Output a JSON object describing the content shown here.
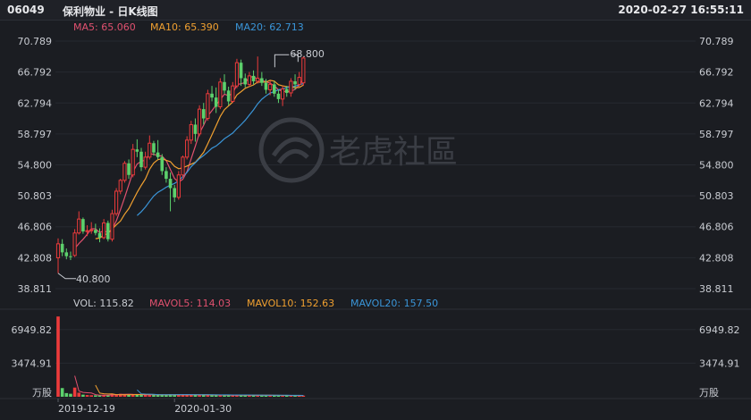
{
  "header": {
    "code": "06049",
    "name": "保利物业 - 日K线图",
    "datetime": "2020-02-27 16:55:11"
  },
  "ma_legend": [
    {
      "label": "MA5: 65.060",
      "color": "#e0516f"
    },
    {
      "label": "MA10: 65.390",
      "color": "#f0a030"
    },
    {
      "label": "MA20: 62.713",
      "color": "#3a95d8"
    }
  ],
  "vol_legend": [
    {
      "label": "VOL: 115.82",
      "color": "#c9ccd2"
    },
    {
      "label": "MAVOL5: 114.03",
      "color": "#e0516f"
    },
    {
      "label": "MAVOL10: 152.63",
      "color": "#f0a030"
    },
    {
      "label": "MAVOL20: 157.50",
      "color": "#3a95d8"
    }
  ],
  "watermark": "老虎社區",
  "colors": {
    "up": "#ec3b3b",
    "down": "#5cd16c"
  },
  "chart_data": [
    {
      "type": "candlestick",
      "title": "保利物业 - 日K线图",
      "price_ticks": [
        "70.789",
        "66.792",
        "62.794",
        "58.797",
        "54.800",
        "50.803",
        "46.806",
        "42.808",
        "38.811"
      ],
      "ylim": [
        38.811,
        70.789
      ],
      "annotations": [
        {
          "label": "68.800",
          "index": 59
        },
        {
          "label": "40.800",
          "index": 0
        }
      ],
      "x_tick_labels": [
        {
          "label": "2019-12-19",
          "index": 0
        },
        {
          "label": "2020-01-30",
          "index": 28
        }
      ],
      "candles": [
        {
          "o": 42.8,
          "h": 45.3,
          "l": 40.8,
          "c": 44.6
        },
        {
          "o": 44.6,
          "h": 45.2,
          "l": 43.0,
          "c": 43.5
        },
        {
          "o": 43.5,
          "h": 44.0,
          "l": 42.6,
          "c": 43.0
        },
        {
          "o": 43.0,
          "h": 43.6,
          "l": 42.5,
          "c": 42.9
        },
        {
          "o": 43.1,
          "h": 46.5,
          "l": 42.9,
          "c": 46.0
        },
        {
          "o": 46.0,
          "h": 48.8,
          "l": 45.8,
          "c": 47.8
        },
        {
          "o": 47.8,
          "h": 48.0,
          "l": 45.9,
          "c": 46.2
        },
        {
          "o": 46.2,
          "h": 47.0,
          "l": 45.6,
          "c": 46.3
        },
        {
          "o": 46.3,
          "h": 47.4,
          "l": 45.9,
          "c": 46.4
        },
        {
          "o": 46.4,
          "h": 47.2,
          "l": 45.7,
          "c": 46.0
        },
        {
          "o": 46.0,
          "h": 46.6,
          "l": 44.8,
          "c": 45.4
        },
        {
          "o": 45.4,
          "h": 47.8,
          "l": 45.2,
          "c": 47.3
        },
        {
          "o": 47.3,
          "h": 47.6,
          "l": 44.9,
          "c": 45.2
        },
        {
          "o": 45.2,
          "h": 49.0,
          "l": 44.9,
          "c": 48.5
        },
        {
          "o": 48.5,
          "h": 51.8,
          "l": 48.2,
          "c": 51.4
        },
        {
          "o": 51.4,
          "h": 53.0,
          "l": 51.0,
          "c": 52.8
        },
        {
          "o": 52.8,
          "h": 55.3,
          "l": 52.5,
          "c": 55.0
        },
        {
          "o": 55.0,
          "h": 55.5,
          "l": 53.0,
          "c": 53.5
        },
        {
          "o": 53.5,
          "h": 57.5,
          "l": 53.2,
          "c": 56.8
        },
        {
          "o": 56.8,
          "h": 58.1,
          "l": 55.8,
          "c": 56.5
        },
        {
          "o": 56.5,
          "h": 57.0,
          "l": 54.0,
          "c": 54.5
        },
        {
          "o": 54.5,
          "h": 56.5,
          "l": 54.2,
          "c": 55.8
        },
        {
          "o": 55.8,
          "h": 58.6,
          "l": 55.5,
          "c": 57.6
        },
        {
          "o": 57.6,
          "h": 57.9,
          "l": 56.0,
          "c": 56.4
        },
        {
          "o": 56.4,
          "h": 58.0,
          "l": 55.5,
          "c": 55.8
        },
        {
          "o": 55.8,
          "h": 56.2,
          "l": 53.5,
          "c": 54.0
        },
        {
          "o": 54.0,
          "h": 54.5,
          "l": 52.5,
          "c": 53.0
        },
        {
          "o": 53.0,
          "h": 53.8,
          "l": 48.8,
          "c": 51.8
        },
        {
          "o": 51.8,
          "h": 52.2,
          "l": 50.0,
          "c": 50.6
        },
        {
          "o": 50.6,
          "h": 54.0,
          "l": 50.3,
          "c": 53.5
        },
        {
          "o": 53.5,
          "h": 56.0,
          "l": 53.2,
          "c": 55.8
        },
        {
          "o": 55.8,
          "h": 58.5,
          "l": 55.5,
          "c": 58.0
        },
        {
          "o": 58.0,
          "h": 60.5,
          "l": 57.5,
          "c": 60.0
        },
        {
          "o": 60.0,
          "h": 60.8,
          "l": 57.8,
          "c": 58.8
        },
        {
          "o": 58.8,
          "h": 62.5,
          "l": 58.5,
          "c": 62.0
        },
        {
          "o": 62.0,
          "h": 62.8,
          "l": 60.0,
          "c": 60.8
        },
        {
          "o": 60.8,
          "h": 64.5,
          "l": 60.5,
          "c": 64.0
        },
        {
          "o": 64.0,
          "h": 65.0,
          "l": 63.0,
          "c": 63.5
        },
        {
          "o": 63.5,
          "h": 64.8,
          "l": 61.5,
          "c": 62.3
        },
        {
          "o": 62.3,
          "h": 66.0,
          "l": 62.0,
          "c": 65.5
        },
        {
          "o": 65.5,
          "h": 66.5,
          "l": 64.0,
          "c": 64.4
        },
        {
          "o": 64.4,
          "h": 64.9,
          "l": 62.5,
          "c": 63.0
        },
        {
          "o": 63.0,
          "h": 65.5,
          "l": 62.8,
          "c": 65.0
        },
        {
          "o": 65.0,
          "h": 68.5,
          "l": 64.7,
          "c": 68.0
        },
        {
          "o": 68.0,
          "h": 68.4,
          "l": 65.0,
          "c": 66.0
        },
        {
          "o": 66.0,
          "h": 66.6,
          "l": 64.8,
          "c": 65.2
        },
        {
          "o": 65.2,
          "h": 66.8,
          "l": 64.9,
          "c": 66.3
        },
        {
          "o": 66.3,
          "h": 67.0,
          "l": 65.2,
          "c": 65.6
        },
        {
          "o": 65.6,
          "h": 68.8,
          "l": 65.3,
          "c": 66.0
        },
        {
          "o": 66.0,
          "h": 66.8,
          "l": 65.0,
          "c": 65.4
        },
        {
          "o": 65.4,
          "h": 65.9,
          "l": 64.0,
          "c": 64.5
        },
        {
          "o": 64.5,
          "h": 65.7,
          "l": 63.8,
          "c": 65.2
        },
        {
          "o": 65.2,
          "h": 65.6,
          "l": 63.6,
          "c": 64.0
        },
        {
          "o": 64.0,
          "h": 64.5,
          "l": 62.8,
          "c": 63.3
        },
        {
          "o": 63.3,
          "h": 65.0,
          "l": 62.4,
          "c": 64.6
        },
        {
          "o": 64.6,
          "h": 65.0,
          "l": 63.6,
          "c": 64.1
        },
        {
          "o": 64.1,
          "h": 66.0,
          "l": 63.6,
          "c": 65.6
        },
        {
          "o": 65.6,
          "h": 66.5,
          "l": 64.5,
          "c": 65.2
        },
        {
          "o": 65.2,
          "h": 66.8,
          "l": 64.9,
          "c": 66.1
        },
        {
          "o": 65.4,
          "h": 68.8,
          "l": 65.0,
          "c": 68.6
        }
      ]
    },
    {
      "type": "bar",
      "title": "VOL",
      "y_ticks": [
        "6949.82",
        "3474.91"
      ],
      "unit_label": "万股",
      "ylim": [
        0,
        8500
      ],
      "values": [
        8300,
        900,
        380,
        310,
        950,
        420,
        220,
        180,
        160,
        150,
        130,
        210,
        170,
        330,
        260,
        300,
        250,
        200,
        230,
        220,
        190,
        210,
        230,
        200,
        180,
        190,
        170,
        260,
        210,
        230,
        190,
        200,
        210,
        190,
        200,
        170,
        180,
        160,
        170,
        180,
        150,
        160,
        170,
        190,
        160,
        150,
        140,
        150,
        160,
        140,
        130,
        150,
        140,
        130,
        140,
        120,
        130,
        120,
        110,
        116
      ]
    }
  ]
}
